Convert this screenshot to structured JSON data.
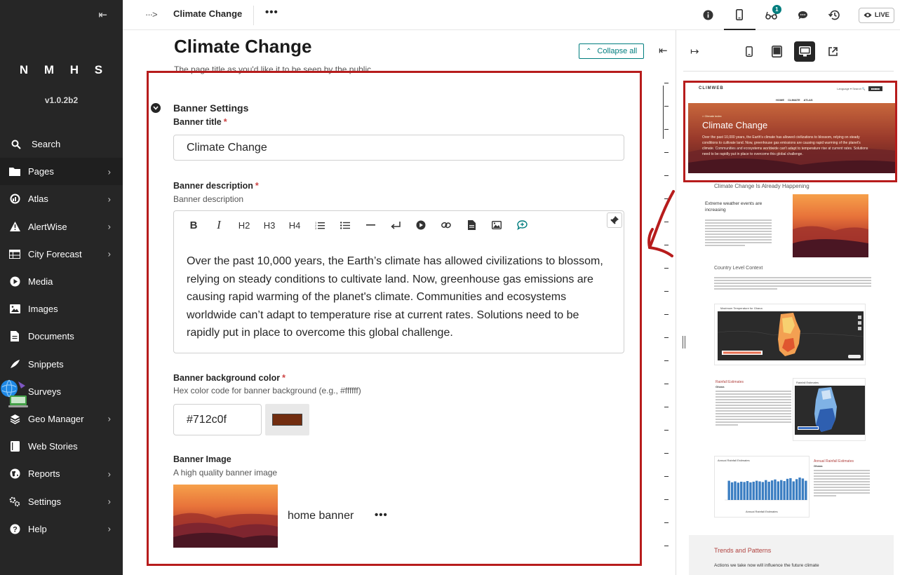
{
  "sidebar": {
    "logo": "N M H S",
    "version": "v1.0.2b2",
    "items": [
      {
        "label": "Search",
        "icon": "search-icon"
      },
      {
        "label": "Pages",
        "icon": "folder-icon"
      },
      {
        "label": "Atlas",
        "icon": "atlas-icon"
      },
      {
        "label": "AlertWise",
        "icon": "warning-icon"
      },
      {
        "label": "City Forecast",
        "icon": "table-icon"
      },
      {
        "label": "Media",
        "icon": "play-icon"
      },
      {
        "label": "Images",
        "icon": "image-icon"
      },
      {
        "label": "Documents",
        "icon": "document-icon"
      },
      {
        "label": "Snippets",
        "icon": "snippet-icon"
      },
      {
        "label": "Surveys",
        "icon": "survey-icon"
      },
      {
        "label": "Geo Manager",
        "icon": "layers-icon"
      },
      {
        "label": "Web Stories",
        "icon": "book-icon"
      },
      {
        "label": "Reports",
        "icon": "globe-icon"
      },
      {
        "label": "Settings",
        "icon": "cogs-icon"
      },
      {
        "label": "Help",
        "icon": "help-icon"
      }
    ]
  },
  "header": {
    "breadcrumb": "···>",
    "title": "Climate Change",
    "more": "•••",
    "notification_count": "1",
    "live_label": "LIVE"
  },
  "editor": {
    "page_title": "Climate Change",
    "page_help": "The page title as you'd like it to be seen by the public",
    "collapse_all": "Collapse all",
    "section_label": "Banner Settings",
    "banner_title_label": "Banner title",
    "banner_title_value": "Climate Change",
    "required_mark": "*",
    "banner_desc_label": "Banner description",
    "banner_desc_help": "Banner description",
    "toolbar": {
      "bold": "B",
      "italic": "I",
      "h2": "H2",
      "h3": "H3",
      "h4": "H4"
    },
    "banner_desc_text": "Over the past 10,000 years, the Earth’s climate has allowed civilizations to blossom, relying on steady conditions to cultivate land. Now, greenhouse gas emissions are causing rapid warming of the planet's climate. Communities and ecosystems worldwide can’t adapt to temperature rise at current rates. Solutions need to be rapidly put in place to overcome this global challenge.",
    "bg_color_label": "Banner background color",
    "bg_color_help": "Hex color code for banner background (e.g., #ffffff)",
    "bg_color_value": "#712c0f",
    "banner_image_label": "Banner Image",
    "banner_image_help": "A high quality banner image",
    "banner_image_name": "home banner",
    "image_more": "•••"
  },
  "preview": {
    "site_logo": "CLIMWEB",
    "site_tools": "Language ▾   Search 🔍",
    "site_menu": "HOME   CLIMATE ATLAS",
    "banner_breadcrumb": "> Climate index",
    "banner_title": "Climate Change",
    "banner_desc": "Over the past 10,000 years, the Earth's climate has allowed civilizations to blossom, relying on steady conditions to cultivate land. Now, greenhouse gas emissions are causing rapid warming of the planet's climate. Communities and ecosystems worldwide can't adapt to temperature rise at current rates. Solutions need to be rapidly put in place to overcome this global challenge.",
    "section1": "Climate Change Is Already Happening",
    "sub1": "Extreme weather events are increasing",
    "section2": "Country Level Context",
    "map1_title": "Maximum Temperature for Ghana",
    "rain_title": "Rainfall Estimates",
    "rain_sub": "Ghana",
    "map2_title": "Rainfall Estimates",
    "chart_title": "Annual Rainfall Estimates",
    "chart_side_title": "Annual Rainfall Estimates",
    "chart_side_sub": "Ghana",
    "chart_legend": "Annual Rainfall Estimates",
    "trends_title": "Trends and Patterns",
    "trends_sub": "Actions we take now will influence the future climate"
  },
  "colors": {
    "accent": "#007d7e",
    "highlight": "#b71c1c",
    "banner_bg": "#712c0f",
    "sidebar_bg": "#262626"
  },
  "chart_data": {
    "type": "bar",
    "values": [
      60,
      55,
      58,
      54,
      57,
      56,
      59,
      55,
      57,
      60,
      58,
      56,
      62,
      57,
      61,
      64,
      58,
      62,
      59,
      66,
      68,
      58,
      65,
      70,
      67,
      60
    ],
    "legend": "Annual Rainfall Estimates"
  }
}
